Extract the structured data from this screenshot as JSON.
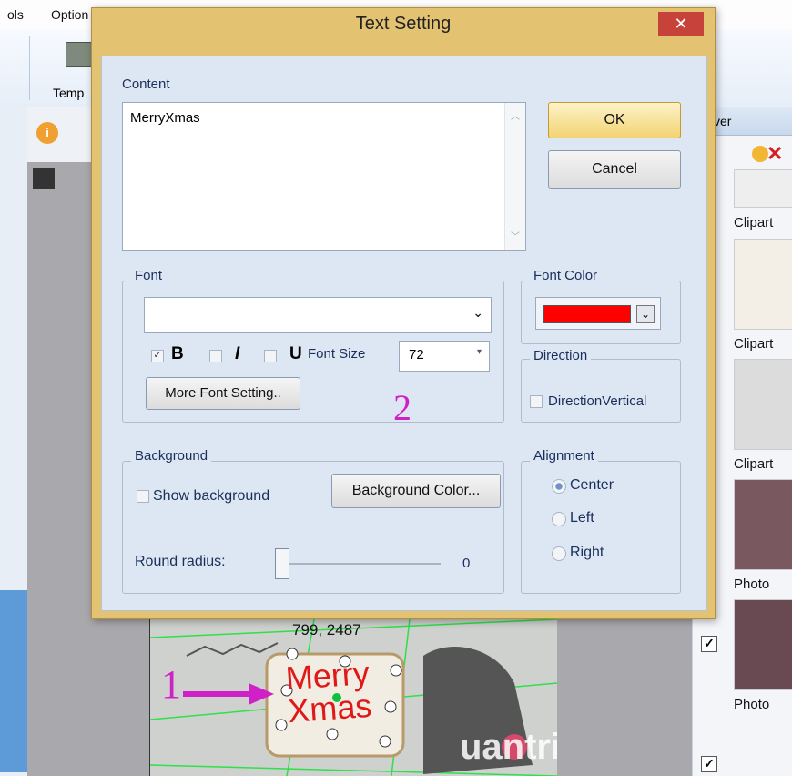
{
  "app": {
    "menu": [
      "ols",
      "Option"
    ],
    "ribbon_label": "Temp",
    "right_panel_title": "ver",
    "items": [
      {
        "label": "Clipart",
        "checked": false
      },
      {
        "label": "Clipart",
        "checked": false
      },
      {
        "label": "Clipart",
        "checked": false
      },
      {
        "label": "Photo",
        "checked": false
      },
      {
        "label": "Photo",
        "checked": true
      }
    ],
    "coords": "799, 2487",
    "canvas_text": "Merry\nXmas",
    "annotations": {
      "one": "1",
      "two": "2"
    },
    "watermark": "uantrimang"
  },
  "dialog": {
    "title": "Text Setting",
    "close_glyph": "✕",
    "content_label": "Content",
    "content_value": "MerryXmas",
    "ok_label": "OK",
    "cancel_label": "Cancel",
    "font": {
      "group_label": "Font",
      "family_value": "",
      "bold": "B",
      "italic": "I",
      "underline": "U",
      "bold_checked": true,
      "size_label": "Font Size",
      "size_value": "72",
      "more_label": "More Font Setting.."
    },
    "font_color": {
      "group_label": "Font Color",
      "value": "#ff0000"
    },
    "direction": {
      "group_label": "Direction",
      "vertical_label": "DirectionVertical"
    },
    "background": {
      "group_label": "Background",
      "show_label": "Show background",
      "color_button": "Background Color...",
      "radius_label": "Round radius:",
      "radius_value": "0"
    },
    "alignment": {
      "group_label": "Alignment",
      "options": [
        "Center",
        "Left",
        "Right"
      ],
      "selected": "Center"
    }
  },
  "colors": {
    "dialog_frame": "#e3c372",
    "close_button": "#c7423b",
    "annotation": "#d020c8"
  }
}
